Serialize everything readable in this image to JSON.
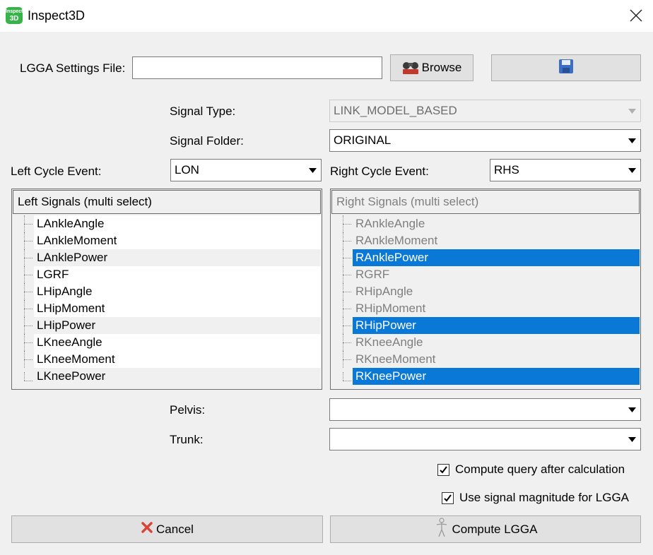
{
  "window": {
    "title": "Inspect3D",
    "icon_text_top": "Inspect",
    "icon_text_bottom": "3D"
  },
  "settings": {
    "file_label": "LGGA Settings File:",
    "file_value": "",
    "browse_label": "Browse",
    "browse_icon_text": "CMO"
  },
  "signal_type": {
    "label": "Signal Type:",
    "value": "LINK_MODEL_BASED"
  },
  "signal_folder": {
    "label": "Signal Folder:",
    "value": "ORIGINAL"
  },
  "left_cycle": {
    "label": "Left Cycle Event:",
    "value": "LON"
  },
  "right_cycle": {
    "label": "Right Cycle Event:",
    "value": "RHS"
  },
  "left_signals": {
    "header": "Left Signals (multi select)",
    "items": [
      "LAnkleAngle",
      "LAnkleMoment",
      "LAnklePower",
      "LGRF",
      "LHipAngle",
      "LHipMoment",
      "LHipPower",
      "LKneeAngle",
      "LKneeMoment",
      "LKneePower"
    ]
  },
  "right_signals": {
    "header": "Right Signals (multi select)",
    "items": [
      "RAnkleAngle",
      "RAnkleMoment",
      "RAnklePower",
      "RGRF",
      "RHipAngle",
      "RHipMoment",
      "RHipPower",
      "RKneeAngle",
      "RKneeMoment",
      "RKneePower"
    ],
    "selected": [
      "RAnklePower",
      "RHipPower",
      "RKneePower"
    ]
  },
  "pelvis": {
    "label": "Pelvis:",
    "value": ""
  },
  "trunk": {
    "label": "Trunk:",
    "value": ""
  },
  "options": {
    "compute_query": {
      "label": "Compute query after calculation",
      "checked": true
    },
    "use_magnitude": {
      "label": "Use signal magnitude for LGGA",
      "checked": true
    }
  },
  "actions": {
    "cancel_label": "Cancel",
    "compute_label": "Compute LGGA"
  },
  "colors": {
    "selection": "#0a78d7",
    "app_icon": "#37b34a",
    "cancel_icon": "#d9443a",
    "save_icon": "#3b6fc4"
  }
}
